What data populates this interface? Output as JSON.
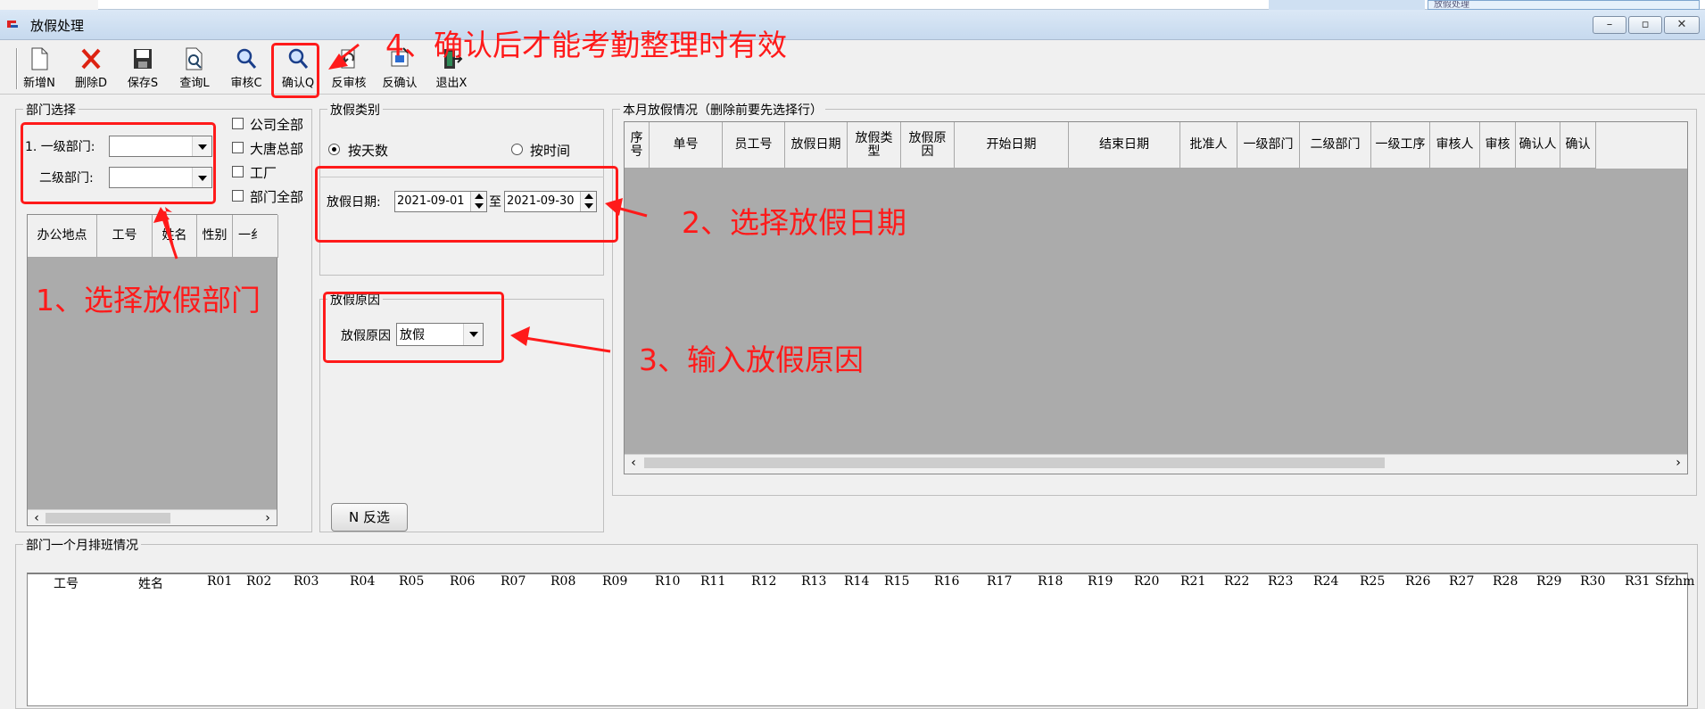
{
  "window": {
    "title": "放假处理"
  },
  "toolbar": {
    "buttons": [
      {
        "label": "新增N",
        "icon": "new-document-icon"
      },
      {
        "label": "删除D",
        "icon": "delete-x-icon"
      },
      {
        "label": "保存S",
        "icon": "save-icon"
      },
      {
        "label": "查询L",
        "icon": "query-icon"
      },
      {
        "label": "审核C",
        "icon": "review-icon"
      },
      {
        "label": "确认Q",
        "icon": "confirm-magnifier-icon"
      },
      {
        "label": "反审核",
        "icon": "unreview-icon"
      },
      {
        "label": "反确认",
        "icon": "unconfirm-icon"
      },
      {
        "label": "退出X",
        "icon": "exit-icon"
      }
    ]
  },
  "dept": {
    "group_label": "部门选择",
    "level1_label": "1. 一级部门:",
    "level2_label": "二级部门:",
    "level1_value": "",
    "level2_value": "",
    "checkboxes": [
      "公司全部",
      "大唐总部",
      "工厂",
      "部门全部"
    ],
    "columns": [
      "办公地点",
      "工号",
      "姓名",
      "性别",
      "一纟"
    ]
  },
  "leave_type": {
    "group_label": "放假类别",
    "by_day": "按天数",
    "by_time": "按时间",
    "date_label": "放假日期:",
    "date_from": "2021-09-01",
    "to_label": "至",
    "date_to": "2021-09-30"
  },
  "leave_reason": {
    "group_label": "放假原因",
    "label": "放假原因",
    "value": "放假"
  },
  "month_leave": {
    "group_label": "本月放假情况（删除前要先选择行）",
    "columns": [
      "序号",
      "单号",
      "员工号",
      "放假日期",
      "放假类型",
      "放假原因",
      "开始日期",
      "结束日期",
      "批准人",
      "一级部门",
      "二级部门",
      "一级工序",
      "审核人",
      "审核",
      "确认人",
      "确认"
    ]
  },
  "invert_button": {
    "label": "N 反选"
  },
  "schedule": {
    "group_label": "部门一个月排班情况",
    "columns": [
      "工号",
      "姓名",
      "R01",
      "R02",
      "R03",
      "R04",
      "R05",
      "R06",
      "R07",
      "R08",
      "R09",
      "R10",
      "R11",
      "R12",
      "R13",
      "R14",
      "R15",
      "R16",
      "R17",
      "R18",
      "R19",
      "R20",
      "R21",
      "R22",
      "R23",
      "R24",
      "R25",
      "R26",
      "R27",
      "R28",
      "R29",
      "R30",
      "R31",
      "Sfzhm"
    ]
  },
  "top_strip": {
    "window_chip": "放假处理"
  },
  "annotations": {
    "a1": "1、选择放假部门",
    "a2": "2、选择放假日期",
    "a3": "3、输入放假原因",
    "a4": "4、确认后才能考勤整理时有效"
  },
  "colors": {
    "annotation": "#ff1a1a",
    "grid_body": "#ababab",
    "titlebar": "#c6d9ee"
  }
}
